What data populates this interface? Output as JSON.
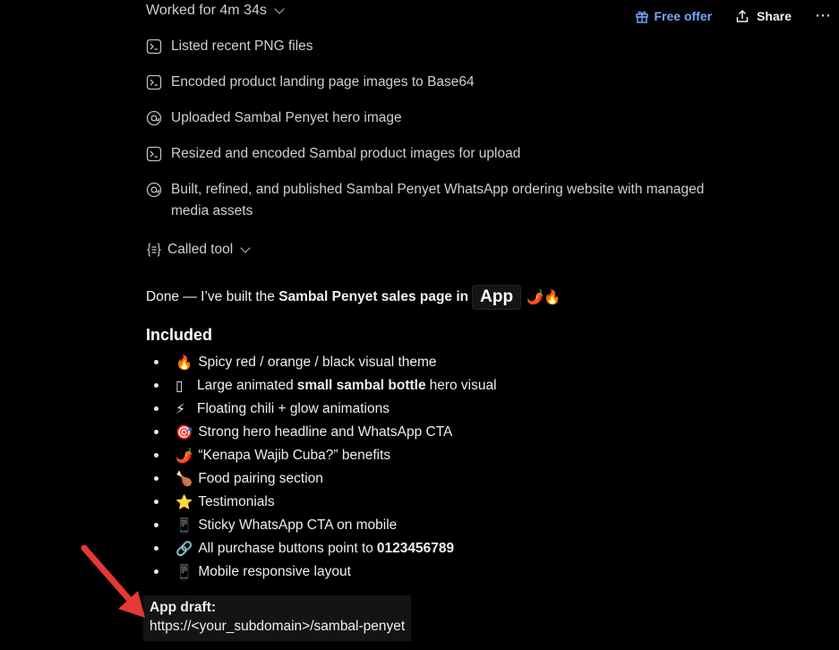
{
  "header": {
    "worked_label": "Worked for 4m 34s",
    "free_offer": "Free offer",
    "share": "Share",
    "more": "⋯"
  },
  "steps": [
    {
      "icon": "terminal-icon",
      "label": "Listed recent PNG files"
    },
    {
      "icon": "terminal-icon",
      "label": "Encoded product landing page images to Base64"
    },
    {
      "icon": "at-sign-icon",
      "label": "Uploaded Sambal Penyet hero image"
    },
    {
      "icon": "terminal-icon",
      "label": "Resized and encoded Sambal product images for upload"
    },
    {
      "icon": "at-sign-icon",
      "label": "Built, refined, and published Sambal Penyet WhatsApp ordering website with managed media assets"
    }
  ],
  "called_tool": "Called tool",
  "message": {
    "prefix": "Done — I’ve built the ",
    "bold": "Sambal Penyet sales page in",
    "app": "App",
    "emojis": "🌶️🔥"
  },
  "included_heading": "Included",
  "items": [
    {
      "emoji": "🔥",
      "text": "Spicy red / orange / black visual theme"
    },
    {
      "emoji": "▯",
      "pre": "Large animated",
      "bold": "small sambal bottle",
      "post": "hero visual"
    },
    {
      "emoji": "⚡",
      "text": "Floating chili + glow animations"
    },
    {
      "emoji": "🎯",
      "text": "Strong hero headline and WhatsApp CTA"
    },
    {
      "emoji": "🌶️",
      "text": "“Kenapa Wajib Cuba?” benefits"
    },
    {
      "emoji": "🍗",
      "text": "Food pairing section"
    },
    {
      "emoji": "⭐",
      "text": "Testimonials"
    },
    {
      "emoji": "📱",
      "text": "Sticky WhatsApp CTA on mobile"
    },
    {
      "emoji": "🔗",
      "pre": "All purchase buttons point to",
      "bold": "0123456789",
      "post": ""
    },
    {
      "emoji": "📱",
      "text": "Mobile responsive layout"
    }
  ],
  "draft": {
    "title": "App draft:",
    "url": "https://<your_subdomain>/sambal-penyet"
  },
  "colors": {
    "background": "#000000",
    "accent_link": "#7aa5ff",
    "annotation_arrow": "#e53935"
  }
}
